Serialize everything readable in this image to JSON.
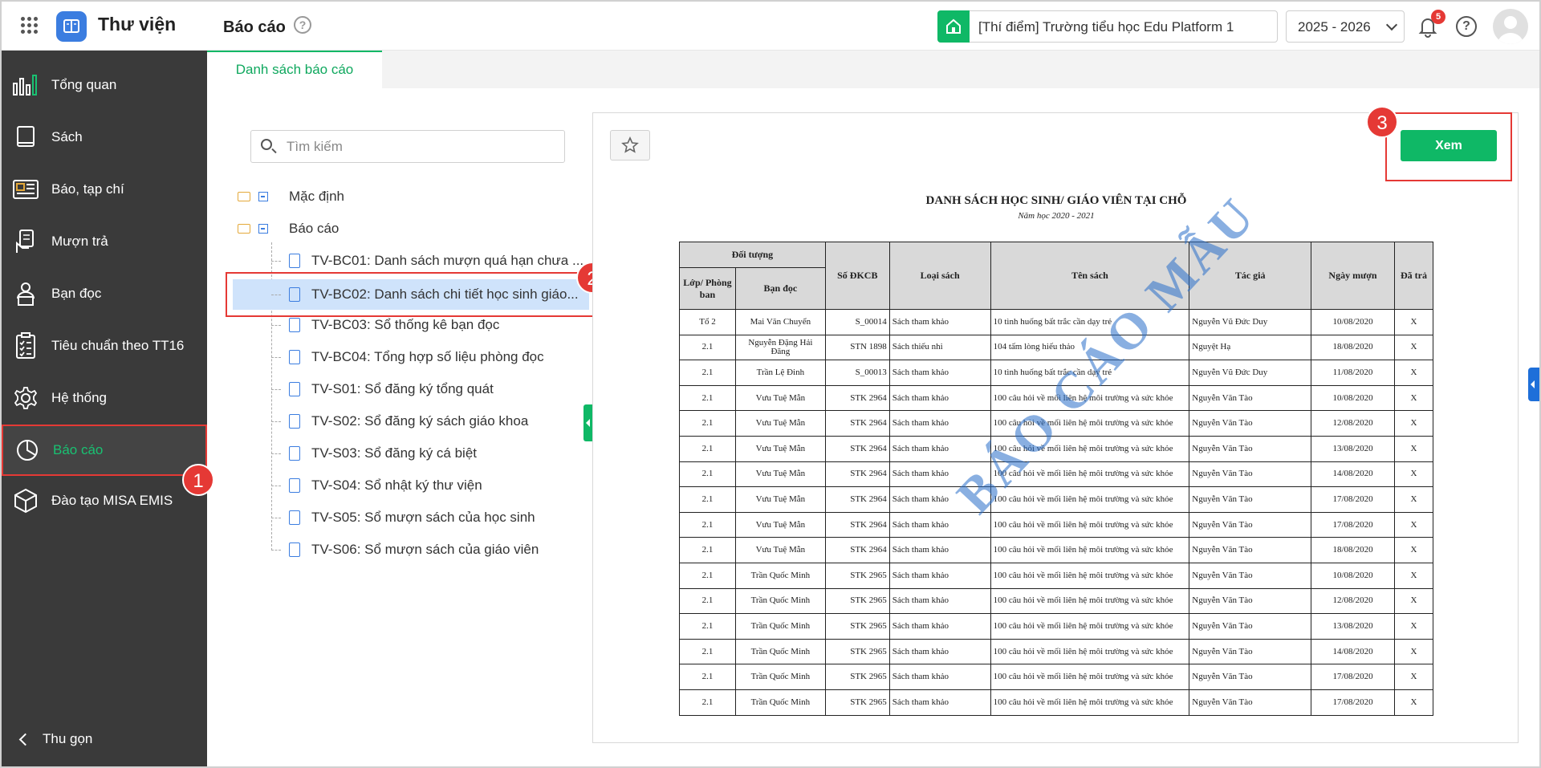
{
  "header": {
    "app_name": "Thư viện",
    "page_title": "Báo cáo",
    "help_glyph": "?",
    "school": "[Thí điểm] Trường tiểu học Edu Platform 1",
    "year": "2025 - 2026",
    "notification_count": "5"
  },
  "sidebar": {
    "items": [
      {
        "label": "Tổng quan",
        "icon": "chart-bars-icon"
      },
      {
        "label": "Sách",
        "icon": "book-icon"
      },
      {
        "label": "Báo, tạp chí",
        "icon": "newspaper-icon"
      },
      {
        "label": "Mượn trả",
        "icon": "borrow-return-icon"
      },
      {
        "label": "Bạn đọc",
        "icon": "reader-icon"
      },
      {
        "label": "Tiêu chuẩn theo TT16",
        "icon": "clipboard-check-icon"
      },
      {
        "label": "Hệ thống",
        "icon": "gear-icon"
      },
      {
        "label": "Báo cáo",
        "icon": "pie-chart-icon",
        "active": true
      },
      {
        "label": "Đào tạo MISA EMIS",
        "icon": "cube-icon"
      }
    ],
    "collapse_label": "Thu gọn"
  },
  "steps": {
    "one": "1",
    "two": "2",
    "three": "3"
  },
  "tabs": {
    "active": "Danh sách báo cáo"
  },
  "search": {
    "placeholder": "Tìm kiếm"
  },
  "tree": {
    "folders": [
      "Mặc định",
      "Báo cáo"
    ],
    "items": [
      "TV-BC01: Danh sách mượn quá hạn chưa ...",
      "TV-BC02: Danh sách chi tiết học sinh giáo...",
      "TV-BC03: Sổ thống kê bạn đọc",
      "TV-BC04: Tổng hợp số liệu phòng đọc",
      "TV-S01: Sổ đăng ký tổng quát",
      "TV-S02: Sổ đăng ký sách giáo khoa",
      "TV-S03: Sổ đăng ký cá biệt",
      "TV-S04: Sổ nhật ký thư viện",
      "TV-S05: Sổ mượn sách của học sinh",
      "TV-S06: Sổ mượn sách của giáo viên"
    ]
  },
  "view_button": "Xem",
  "report": {
    "title": "DANH SÁCH HỌC SINH/ GIÁO VIÊN TẠI CHỖ",
    "subtitle": "Năm học 2020 - 2021",
    "watermark": "BÁO CÁO MẪU",
    "headers": {
      "group": "Đối tượng",
      "class": "Lớp/ Phòng ban",
      "reader": "Bạn đọc",
      "code": "Số ĐKCB",
      "type": "Loại sách",
      "book": "Tên sách",
      "author": "Tác giả",
      "date": "Ngày mượn",
      "returned": "Đã trả"
    },
    "rows": [
      [
        "Tổ 2",
        "Mai Văn Chuyển",
        "S_00014",
        "Sách tham khảo",
        "10 tình huống bất trắc cần dạy trẻ",
        "Nguyễn Vũ Đức Duy",
        "10/08/2020",
        "X"
      ],
      [
        "2.1",
        "Nguyễn Đặng Hải Đăng",
        "STN 1898",
        "Sách thiếu nhi",
        "104 tấm lòng hiếu thảo",
        "Nguyệt Hạ",
        "18/08/2020",
        "X"
      ],
      [
        "2.1",
        "Trần Lệ Đinh",
        "S_00013",
        "Sách tham khảo",
        "10 tình huống bất trắc cần dạy trẻ",
        "Nguyễn Vũ Đức Duy",
        "11/08/2020",
        "X"
      ],
      [
        "2.1",
        "Vưu Tuệ Mẫn",
        "STK 2964",
        "Sách tham khảo",
        "100 câu hỏi về mối liên hệ môi trường và sức khỏe",
        "Nguyễn Văn Tào",
        "10/08/2020",
        "X"
      ],
      [
        "2.1",
        "Vưu Tuệ Mẫn",
        "STK 2964",
        "Sách tham khảo",
        "100 câu hỏi về mối liên hệ môi trường và sức khỏe",
        "Nguyễn Văn Tào",
        "12/08/2020",
        "X"
      ],
      [
        "2.1",
        "Vưu Tuệ Mẫn",
        "STK 2964",
        "Sách tham khảo",
        "100 câu hỏi về mối liên hệ môi trường và sức khỏe",
        "Nguyễn Văn Tào",
        "13/08/2020",
        "X"
      ],
      [
        "2.1",
        "Vưu Tuệ Mẫn",
        "STK 2964",
        "Sách tham khảo",
        "100 câu hỏi về mối liên hệ môi trường và sức khỏe",
        "Nguyễn Văn Tào",
        "14/08/2020",
        "X"
      ],
      [
        "2.1",
        "Vưu Tuệ Mẫn",
        "STK 2964",
        "Sách tham khảo",
        "100 câu hỏi về mối liên hệ môi trường và sức khỏe",
        "Nguyễn Văn Tào",
        "17/08/2020",
        "X"
      ],
      [
        "2.1",
        "Vưu Tuệ Mẫn",
        "STK 2964",
        "Sách tham khảo",
        "100 câu hỏi về mối liên hệ môi trường và sức khỏe",
        "Nguyễn Văn Tào",
        "17/08/2020",
        "X"
      ],
      [
        "2.1",
        "Vưu Tuệ Mẫn",
        "STK 2964",
        "Sách tham khảo",
        "100 câu hỏi về mối liên hệ môi trường và sức khỏe",
        "Nguyễn Văn Tào",
        "18/08/2020",
        "X"
      ],
      [
        "2.1",
        "Trần Quốc Minh",
        "STK 2965",
        "Sách tham khảo",
        "100 câu hỏi về mối liên hệ môi trường và sức khỏe",
        "Nguyễn Văn Tào",
        "10/08/2020",
        "X"
      ],
      [
        "2.1",
        "Trần Quốc Minh",
        "STK 2965",
        "Sách tham khảo",
        "100 câu hỏi về mối liên hệ môi trường và sức khỏe",
        "Nguyễn Văn Tào",
        "12/08/2020",
        "X"
      ],
      [
        "2.1",
        "Trần Quốc Minh",
        "STK 2965",
        "Sách tham khảo",
        "100 câu hỏi về mối liên hệ môi trường và sức khỏe",
        "Nguyễn Văn Tào",
        "13/08/2020",
        "X"
      ],
      [
        "2.1",
        "Trần Quốc Minh",
        "STK 2965",
        "Sách tham khảo",
        "100 câu hỏi về mối liên hệ môi trường và sức khỏe",
        "Nguyễn Văn Tào",
        "14/08/2020",
        "X"
      ],
      [
        "2.1",
        "Trần Quốc Minh",
        "STK 2965",
        "Sách tham khảo",
        "100 câu hỏi về mối liên hệ môi trường và sức khỏe",
        "Nguyễn Văn Tào",
        "17/08/2020",
        "X"
      ],
      [
        "2.1",
        "Trần Quốc Minh",
        "STK 2965",
        "Sách tham khảo",
        "100 câu hỏi về mối liên hệ môi trường và sức khỏe",
        "Nguyễn Văn Tào",
        "17/08/2020",
        "X"
      ]
    ]
  },
  "colors": {
    "accent": "#0fb866",
    "sidebar_bg": "#3a3a3a",
    "highlight": "#e53935",
    "selected": "#cfe3fb"
  }
}
